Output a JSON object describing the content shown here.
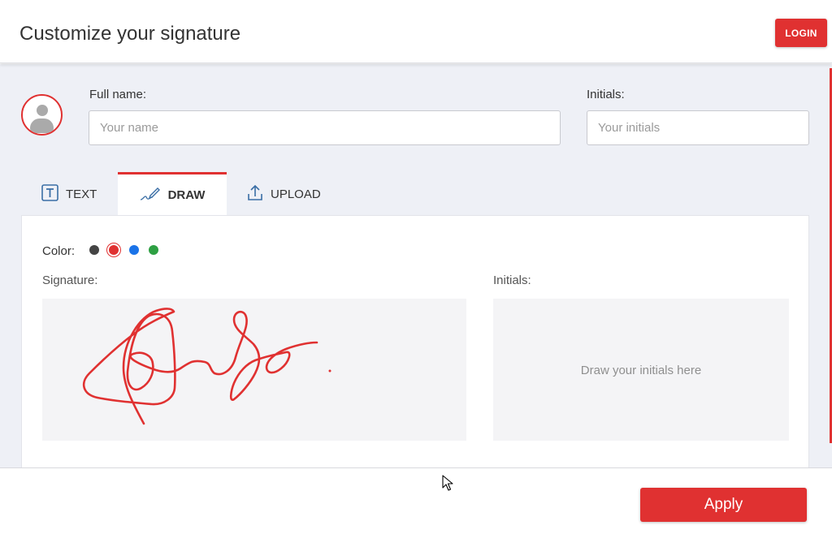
{
  "header": {
    "title": "Customize your signature",
    "login_label": "LOGIN"
  },
  "form": {
    "full_name_label": "Full name:",
    "full_name_placeholder": "Your name",
    "full_name_value": "",
    "initials_label": "Initials:",
    "initials_placeholder": "Your initials",
    "initials_value": ""
  },
  "tabs": [
    {
      "label": "TEXT",
      "icon": "text-box-icon",
      "active": false
    },
    {
      "label": "DRAW",
      "icon": "pen-draw-icon",
      "active": true
    },
    {
      "label": "UPLOAD",
      "icon": "upload-icon",
      "active": false
    }
  ],
  "draw": {
    "color_label": "Color:",
    "colors": [
      "#444444",
      "#e03131",
      "#1a73e8",
      "#2ea043"
    ],
    "selected_color": "#e03131",
    "signature_label": "Signature:",
    "initials_label": "Initials:",
    "initials_hint": "Draw your initials here"
  },
  "footer": {
    "apply_label": "Apply"
  },
  "theme": {
    "accent": "#e03131",
    "background": "#eef0f6"
  }
}
